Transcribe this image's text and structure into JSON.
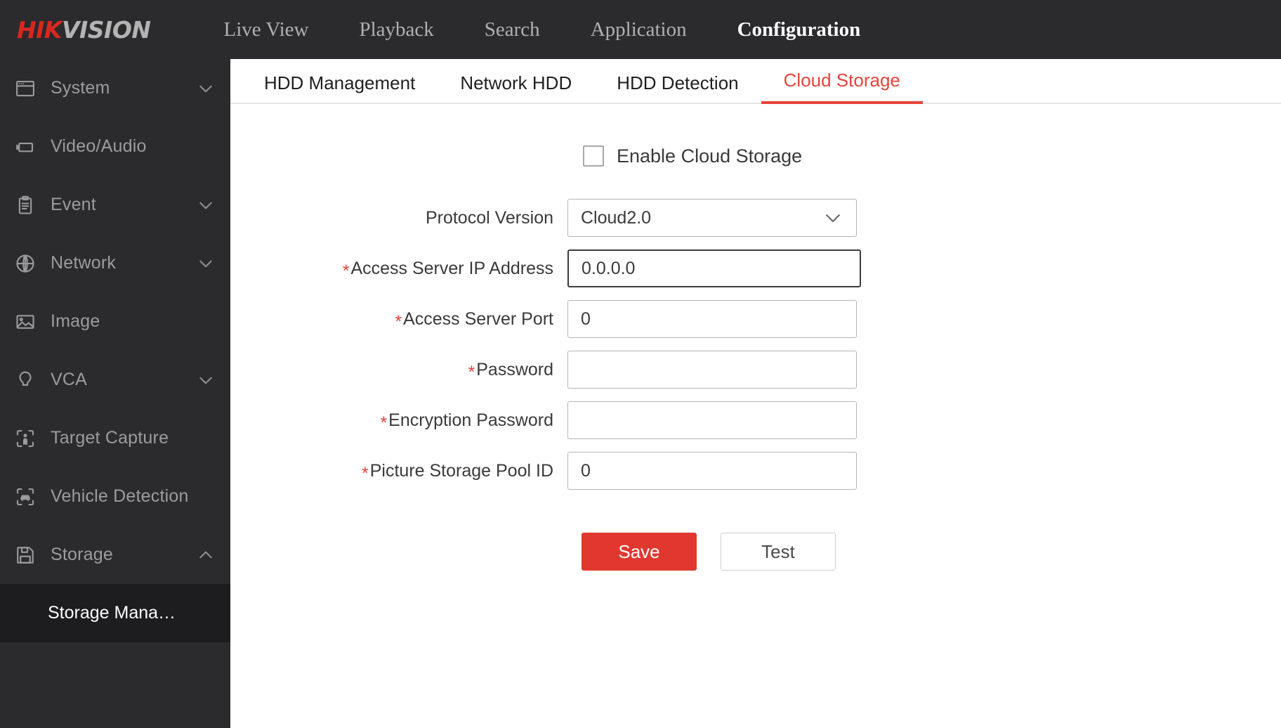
{
  "brand": {
    "prefix": "HIK",
    "suffix": "VISION"
  },
  "nav": {
    "items": [
      {
        "label": "Live View"
      },
      {
        "label": "Playback"
      },
      {
        "label": "Search"
      },
      {
        "label": "Application"
      },
      {
        "label": "Configuration"
      }
    ]
  },
  "sidebar": {
    "items": [
      {
        "label": "System",
        "icon": "window-icon",
        "expandable": true,
        "chevron": "down"
      },
      {
        "label": "Video/Audio",
        "icon": "video-camera-icon",
        "expandable": false,
        "chevron": ""
      },
      {
        "label": "Event",
        "icon": "clipboard-icon",
        "expandable": true,
        "chevron": "down"
      },
      {
        "label": "Network",
        "icon": "globe-icon",
        "expandable": true,
        "chevron": "down"
      },
      {
        "label": "Image",
        "icon": "picture-icon",
        "expandable": false,
        "chevron": ""
      },
      {
        "label": "VCA",
        "icon": "lightbulb-icon",
        "expandable": true,
        "chevron": "down"
      },
      {
        "label": "Target Capture",
        "icon": "person-capture-icon",
        "expandable": false,
        "chevron": ""
      },
      {
        "label": "Vehicle Detection",
        "icon": "vehicle-capture-icon",
        "expandable": false,
        "chevron": ""
      },
      {
        "label": "Storage",
        "icon": "floppy-disk-icon",
        "expandable": true,
        "chevron": "up"
      }
    ],
    "sub_items": [
      {
        "label": "Storage Mana…",
        "active": true
      }
    ]
  },
  "tabs": [
    {
      "label": "HDD Management",
      "active": false
    },
    {
      "label": "Network HDD",
      "active": false
    },
    {
      "label": "HDD Detection",
      "active": false
    },
    {
      "label": "Cloud Storage",
      "active": true
    }
  ],
  "form": {
    "enable_checkbox": {
      "label": "Enable Cloud Storage",
      "checked": false
    },
    "rows": [
      {
        "label": "Protocol Version",
        "required": false,
        "type": "select",
        "value": "Cloud2.0",
        "focused": false
      },
      {
        "label": "Access Server IP Address",
        "required": true,
        "type": "text",
        "value": "0.0.0.0",
        "focused": true
      },
      {
        "label": "Access Server Port",
        "required": true,
        "type": "text",
        "value": "0",
        "focused": false
      },
      {
        "label": "Password",
        "required": true,
        "type": "password",
        "value": "",
        "focused": false
      },
      {
        "label": "Encryption Password",
        "required": true,
        "type": "password",
        "value": "",
        "focused": false
      },
      {
        "label": "Picture Storage Pool ID",
        "required": true,
        "type": "text",
        "value": "0",
        "focused": false
      }
    ],
    "buttons": [
      {
        "label": "Save",
        "style": "primary"
      },
      {
        "label": "Test",
        "style": "secondary"
      }
    ]
  },
  "colors": {
    "brand_red": "#d8271f",
    "accent_red": "#e8433a",
    "save_red": "#e0382f",
    "topbar_bg": "#2b2b2d",
    "sidebar_active_bg": "#1d1d1f"
  }
}
